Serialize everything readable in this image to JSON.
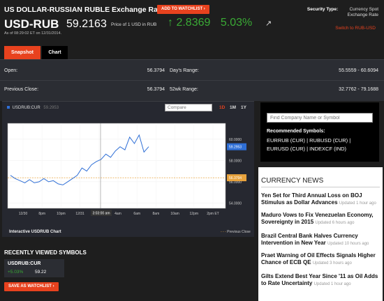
{
  "header": {
    "title": "US DOLLAR-RUSSIAN RUBLE Exchange Rate",
    "watchlist_btn": "ADD TO WATCHLIST",
    "security_type_label": "Security Type:",
    "security_type_value": "Currency Spot Exchange Rate",
    "symbol": "USD-RUB",
    "price": "59.2163",
    "price_label": "Price of 1 USD in RUB",
    "change": "2.8369",
    "change_pct": "5.03%",
    "as_of": "As of 08:29:02 ET on 12/31/2014.",
    "switch_link": "Switch to RUB-USD"
  },
  "tabs": [
    "Snapshot",
    "Chart"
  ],
  "stats": {
    "open_label": "Open:",
    "open_value": "56.3794",
    "day_range_label": "Day's Range:",
    "day_range_value": "55.5559 - 60.6094",
    "prev_close_label": "Previous Close:",
    "prev_close_value": "56.3794",
    "wk52_label": "52wk Range:",
    "wk52_value": "32.7762 - 79.1688"
  },
  "chart_panel": {
    "legend_symbol": "USDRUB:CUR",
    "legend_value": "59.2953",
    "compare_placeholder": "Compare",
    "ranges": [
      "1D",
      "1M",
      "1Y"
    ],
    "active_range": "1D",
    "caption": "Interactive USDRUB Chart",
    "prev_close_legend": "Previous Close",
    "cursor_label": "3:03:00 am",
    "last_badge": "59.2953",
    "prev_badge": "56.3794"
  },
  "chart_data": {
    "type": "line",
    "title": "",
    "series": [
      {
        "name": "USDRUB:CUR",
        "color": "#2f6fd6",
        "values": [
          56.6,
          56.3,
          56.1,
          55.9,
          56.2,
          55.9,
          56.0,
          56.3,
          56.0,
          56.1,
          55.8,
          55.7,
          56.0,
          56.3,
          56.6,
          57.3,
          57.0,
          57.6,
          57.9,
          58.1,
          58.6,
          58.3,
          58.9,
          59.3,
          59.0,
          60.2,
          59.6,
          60.4,
          58.8,
          59.3
        ]
      }
    ],
    "prev_close": 56.3794,
    "x_ticks": [
      "12/30",
      "8pm",
      "10pm",
      "12/31",
      "2am",
      "4am",
      "6am",
      "8am",
      "10am",
      "12pm",
      "2pm ET"
    ],
    "y_ticks": [
      "60.0000",
      "58.0000",
      "56.0000",
      "54.0000"
    ],
    "ylim": [
      53.5,
      61.5
    ]
  },
  "search": {
    "placeholder": "Find Company Name or Symbol",
    "recommended_label": "Recommended Symbols:",
    "line1": "EURRUB (CUR) | RUBUSD (CUR) |",
    "line2": "EURUSD (CUR) | INDEXCF (IND)"
  },
  "news": {
    "title": "CURRENCY NEWS",
    "items": [
      {
        "headline": "Yen Set for Third Annual Loss on BOJ Stimulus as Dollar Advances",
        "time": "Updated 1 hour ago"
      },
      {
        "headline": "Maduro Vows to Fix Venezuelan Economy, Sovereignty in 2015",
        "time": "Updated 6 hours ago"
      },
      {
        "headline": "Brazil Central Bank Halves Currency Intervention in New Year",
        "time": "Updated 10 hours ago"
      },
      {
        "headline": "Praet Warning of Oil Effects Signals Higher Chance of ECB QE",
        "time": "Updated 3 hours ago"
      },
      {
        "headline": "Gilts Extend Best Year Since '11 as Oil Adds to Rate Uncertainty",
        "time": "Updated 1 hour ago"
      }
    ]
  },
  "recent": {
    "title": "RECENTLY VIEWED SYMBOLS",
    "symbol": "USDRUB:CUR",
    "change": "+5.03%",
    "price": "59.22",
    "save_btn": "SAVE AS WATCHLIST"
  },
  "colors": {
    "accent": "#e8421e",
    "up": "#3aaa35",
    "line": "#2f6fd6",
    "prev": "#e8a33d"
  }
}
